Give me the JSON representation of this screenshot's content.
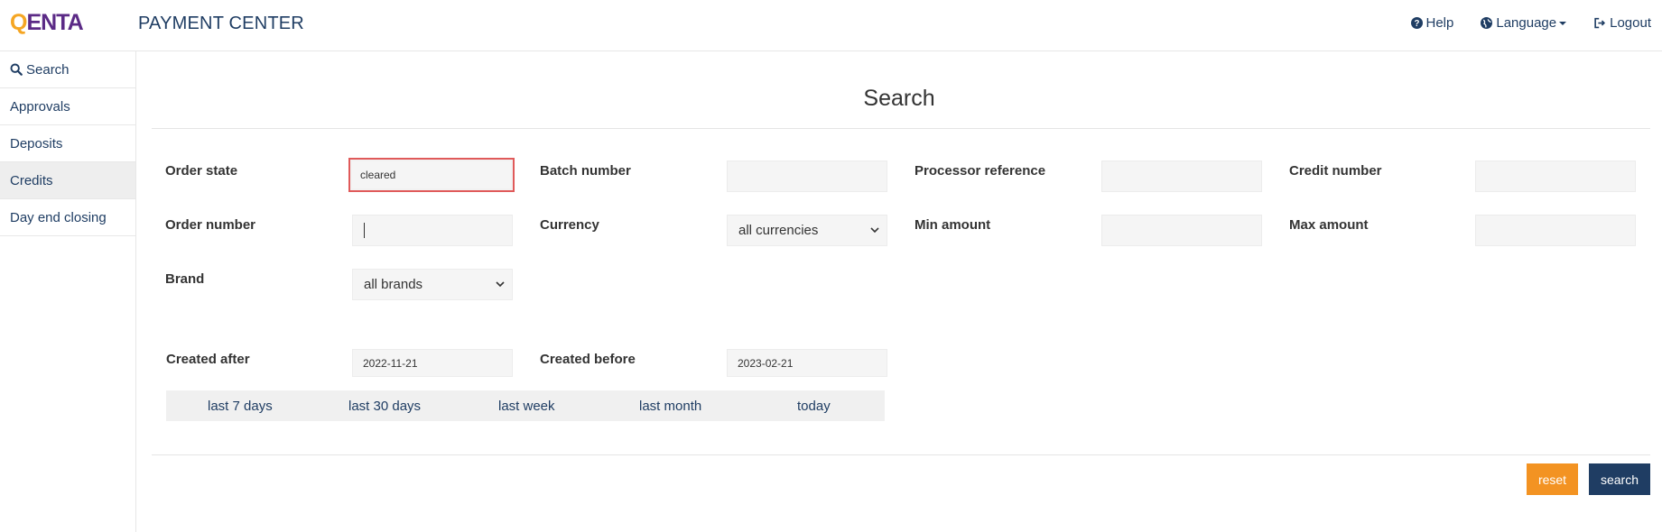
{
  "header": {
    "logo_q": "Q",
    "logo_rest": "ENTA",
    "app_title": "PAYMENT CENTER",
    "help_label": "Help",
    "language_label": "Language",
    "logout_label": "Logout"
  },
  "sidebar": {
    "items": [
      {
        "label": "Search",
        "icon": "search-icon"
      },
      {
        "label": "Approvals"
      },
      {
        "label": "Deposits"
      },
      {
        "label": "Credits",
        "active": true
      },
      {
        "label": "Day end closing"
      }
    ]
  },
  "page": {
    "title": "Search"
  },
  "form": {
    "order_state": {
      "label": "Order state",
      "value": "cleared"
    },
    "batch_number": {
      "label": "Batch number",
      "value": ""
    },
    "processor_reference": {
      "label": "Processor reference",
      "value": ""
    },
    "credit_number": {
      "label": "Credit number",
      "value": ""
    },
    "order_number": {
      "label": "Order number",
      "value": ""
    },
    "currency": {
      "label": "Currency",
      "value": "all currencies"
    },
    "min_amount": {
      "label": "Min amount",
      "value": ""
    },
    "max_amount": {
      "label": "Max amount",
      "value": ""
    },
    "brand": {
      "label": "Brand",
      "value": "all brands"
    },
    "created_after": {
      "label": "Created after",
      "value": "2022-11-21"
    },
    "created_before": {
      "label": "Created before",
      "value": "2023-02-21"
    }
  },
  "quick_ranges": [
    "last 7 days",
    "last 30 days",
    "last week",
    "last month",
    "today"
  ],
  "actions": {
    "reset_label": "reset",
    "search_label": "search"
  },
  "colors": {
    "brand_navy": "#1f3d63",
    "reset_orange": "#f39322",
    "logo_yellow": "#f5a623",
    "logo_purple": "#5b2a86",
    "highlight_red": "#e05a5a"
  }
}
